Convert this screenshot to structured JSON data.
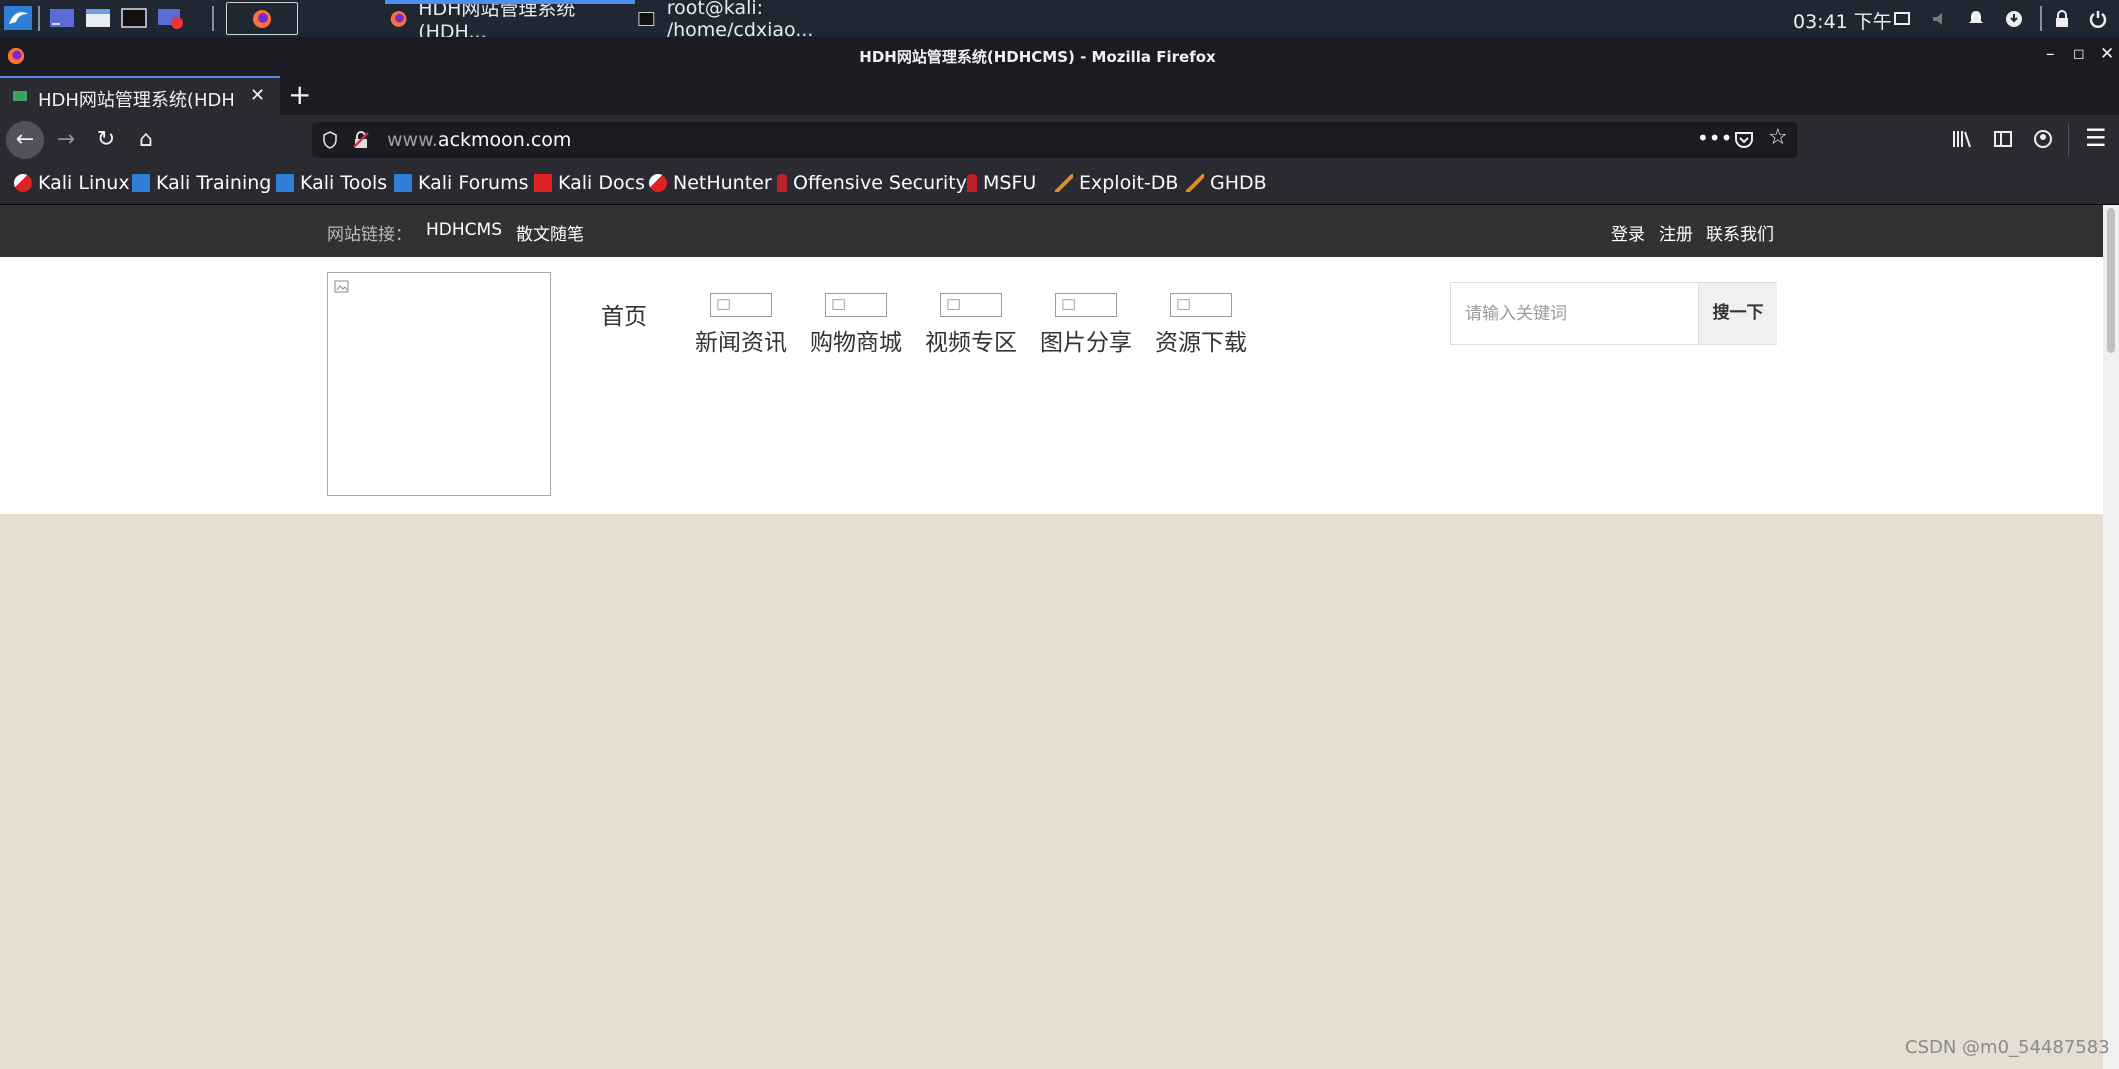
{
  "panel": {
    "tasks": {
      "firefox_window": "HDH网站管理系统(HDH...",
      "terminal_window": "root@kali: /home/cdxiao..."
    },
    "clock": "03:41 下午"
  },
  "window": {
    "title": "HDH网站管理系统(HDHCMS) - Mozilla Firefox",
    "tab_title": "HDH网站管理系统(HDHCMS)",
    "url_prefix": "www.",
    "url_domain": "ackmoon.com"
  },
  "bookmarks": [
    {
      "label": "Kali Linux",
      "icon": "kali-dragon-icon"
    },
    {
      "label": "Kali Training",
      "icon": "kali-blue-icon"
    },
    {
      "label": "Kali Tools",
      "icon": "kali-blue-icon"
    },
    {
      "label": "Kali Forums",
      "icon": "kali-blue-icon"
    },
    {
      "label": "Kali Docs",
      "icon": "kali-docs-icon"
    },
    {
      "label": "NetHunter",
      "icon": "kali-dragon-icon"
    },
    {
      "label": "Offensive Security",
      "icon": "offsec-icon"
    },
    {
      "label": "MSFU",
      "icon": "offsec-icon"
    },
    {
      "label": "Exploit-DB",
      "icon": "exploitdb-icon"
    },
    {
      "label": "GHDB",
      "icon": "exploitdb-icon"
    }
  ],
  "site": {
    "links_label": "网站链接：",
    "links": [
      "HDHCMS",
      "散文随笔"
    ],
    "login": "登录",
    "register": "注册",
    "contact": "联系我们",
    "nav": {
      "home": "首页",
      "items": [
        "新闻资讯",
        "购物商城",
        "视频专区",
        "图片分享",
        "资源下载"
      ]
    },
    "search": {
      "placeholder": "请输入关键词",
      "button": "搜一下"
    }
  },
  "watermark": "CSDN @m0_54487583",
  "colors": {
    "page_background": "#e6ded1",
    "top_strip": "#323232",
    "firefox_dark": "#2b2a33",
    "accent_blue": "#4d8ff0"
  }
}
